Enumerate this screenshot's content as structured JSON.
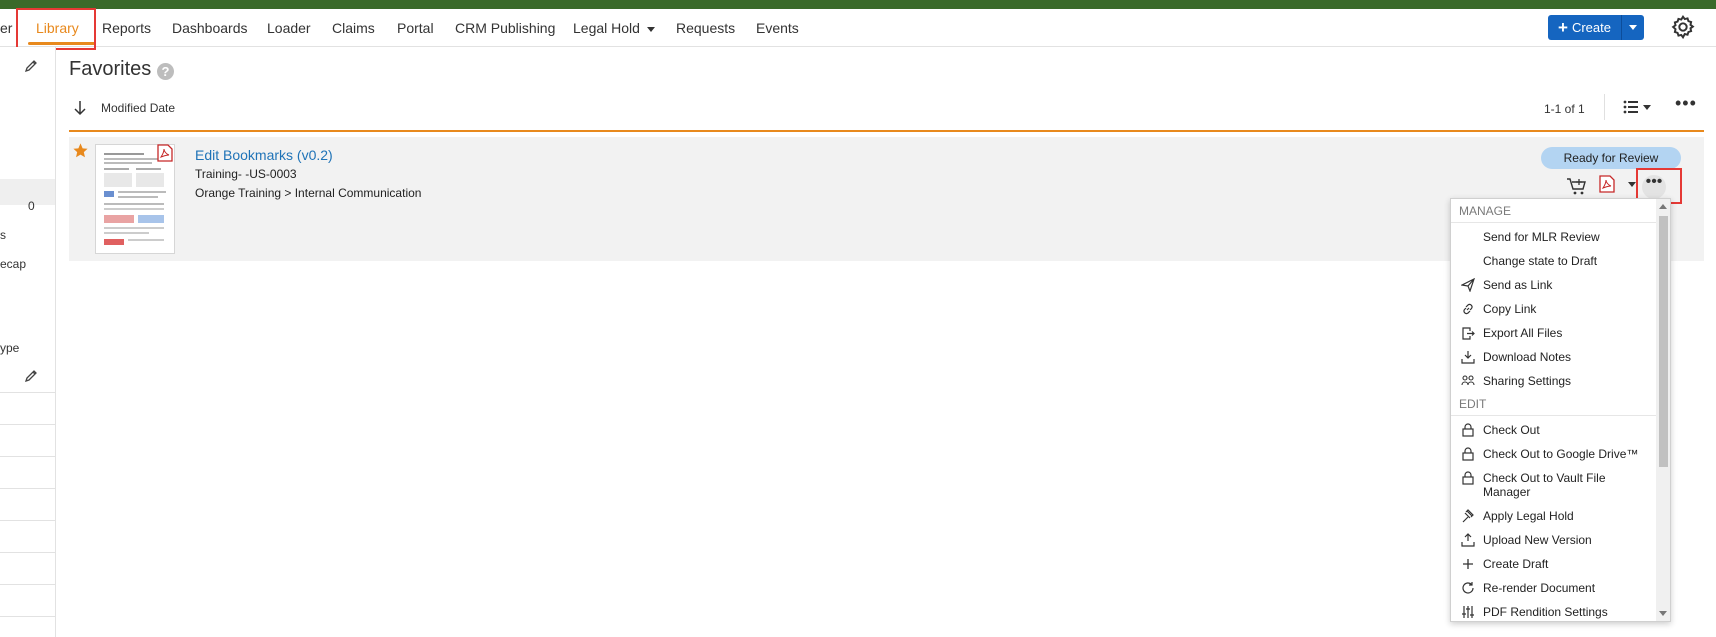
{
  "nav": {
    "partial_left": "er",
    "items": [
      "Library",
      "Reports",
      "Dashboards",
      "Loader",
      "Claims",
      "Portal",
      "CRM Publishing",
      "Legal Hold",
      "Requests",
      "Events"
    ],
    "create_label": "Create"
  },
  "left_panel": {
    "count": "0",
    "items": [
      "s",
      "ecap",
      "ype"
    ]
  },
  "page": {
    "title": "Favorites",
    "help": "?",
    "sort_label": "Modified Date",
    "paging": "1-1 of 1"
  },
  "document": {
    "title": "Edit Bookmarks (v0.2)",
    "number": "Training- -US-0003",
    "path": "Orange Training > Internal Communication",
    "status": "Ready for Review"
  },
  "menu": {
    "manage_header": "MANAGE",
    "edit_header": "EDIT",
    "manage_items": [
      {
        "label": "Send for MLR Review",
        "icon": "none"
      },
      {
        "label": "Change state to Draft",
        "icon": "none"
      },
      {
        "label": "Send as Link",
        "icon": "paper-plane-icon"
      },
      {
        "label": "Copy Link",
        "icon": "link-icon"
      },
      {
        "label": "Export All Files",
        "icon": "file-export-icon"
      },
      {
        "label": "Download Notes",
        "icon": "download-tray-icon"
      },
      {
        "label": "Sharing Settings",
        "icon": "users-icon"
      }
    ],
    "edit_items": [
      {
        "label": "Check Out",
        "icon": "lock-icon"
      },
      {
        "label": "Check Out to Google Drive™",
        "icon": "lock-icon"
      },
      {
        "label": "Check Out to Vault File Manager",
        "icon": "lock-icon"
      },
      {
        "label": "Apply Legal Hold",
        "icon": "gavel-icon"
      },
      {
        "label": "Upload New Version",
        "icon": "upload-tray-icon"
      },
      {
        "label": "Create Draft",
        "icon": "plus-icon"
      },
      {
        "label": "Re-render Document",
        "icon": "refresh-icon"
      },
      {
        "label": "PDF Rendition Settings",
        "icon": "sliders-icon"
      }
    ]
  },
  "colors": {
    "accent_orange": "#e8891d",
    "link_blue": "#1f73b7",
    "primary_button": "#1565c0",
    "status_badge": "#b3d4f2",
    "top_bar_green": "#3a6a2a",
    "highlight_red": "#e53935"
  }
}
